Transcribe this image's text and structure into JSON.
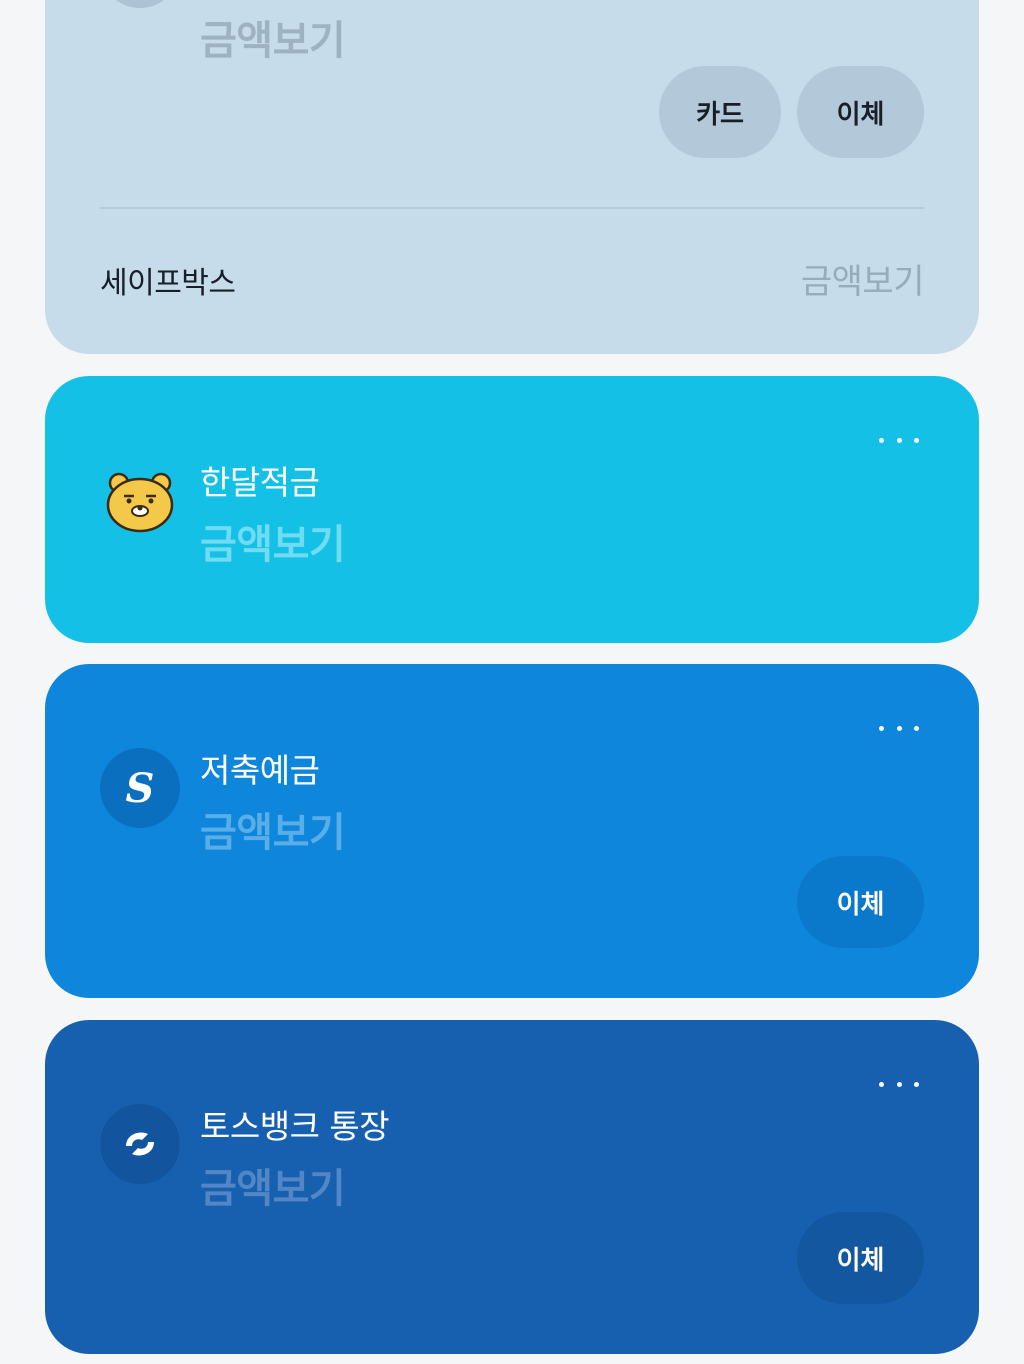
{
  "top_account": {
    "amount_label": "금액보기",
    "card_button": "카드",
    "transfer_button": "이체",
    "safebox_label": "세이프박스",
    "safebox_amount": "금액보기"
  },
  "accounts": [
    {
      "name": "한달적금",
      "amount_label": "금액보기",
      "icon": "ryan-character-icon",
      "color": "#15c0e6"
    },
    {
      "name": "저축예금",
      "amount_label": "금액보기",
      "transfer_button": "이체",
      "icon": "bank-logo-icon",
      "color": "#0d86dc"
    },
    {
      "name": "토스뱅크 통장",
      "amount_label": "금액보기",
      "transfer_button": "이체",
      "icon": "toss-logo-icon",
      "color": "#1760b0"
    }
  ]
}
